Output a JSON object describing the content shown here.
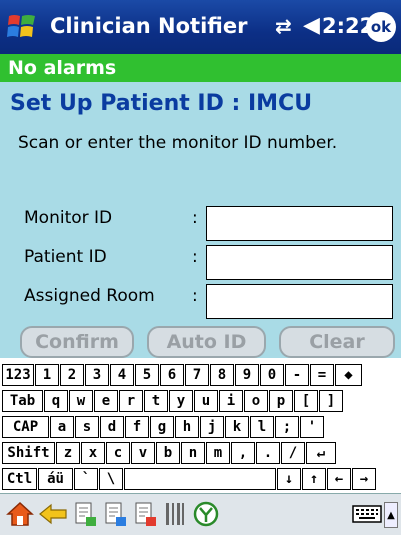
{
  "title_bar": {
    "app_title": "Clinician Notifier",
    "connection_icon": "⇄",
    "volume_icon": "◀",
    "time": "2:22",
    "ok_label": "ok"
  },
  "alarm_status": "No alarms",
  "form": {
    "title": "Set Up Patient ID : IMCU",
    "instructions": "Scan or enter the monitor ID number.",
    "fields": [
      {
        "label": "Monitor ID",
        "value": ""
      },
      {
        "label": "Patient ID",
        "value": ""
      },
      {
        "label": "Assigned Room",
        "value": ""
      }
    ],
    "colon": ":",
    "buttons": {
      "confirm": "Confirm",
      "auto_id": "Auto ID",
      "clear": "Clear"
    }
  },
  "keyboard": {
    "rows": [
      [
        "123",
        "1",
        "2",
        "3",
        "4",
        "5",
        "6",
        "7",
        "8",
        "9",
        "0",
        "-",
        "=",
        "◆"
      ],
      [
        "Tab",
        "q",
        "w",
        "e",
        "r",
        "t",
        "y",
        "u",
        "i",
        "o",
        "p",
        "[",
        "]"
      ],
      [
        "CAP",
        "a",
        "s",
        "d",
        "f",
        "g",
        "h",
        "j",
        "k",
        "l",
        ";",
        "'"
      ],
      [
        "Shift",
        "z",
        "x",
        "c",
        "v",
        "b",
        "n",
        "m",
        ",",
        ".",
        "/",
        "↵"
      ],
      [
        "Ctl",
        "áü",
        "`",
        "\\",
        "",
        "↓",
        "↑",
        "←",
        "→"
      ]
    ]
  },
  "taskbar": {
    "icons": [
      "home-icon",
      "back-arrow-icon",
      "document-icon",
      "document-icon-2",
      "document-icon-3",
      "barcode-icon",
      "y-circle-icon",
      "keyboard-icon"
    ],
    "up_arrow": "▲"
  },
  "colors": {
    "titlebar": "#0c2f86",
    "alarm_green": "#30c030",
    "content_bg": "#a9dbe6",
    "title_blue": "#0a3ca0"
  }
}
